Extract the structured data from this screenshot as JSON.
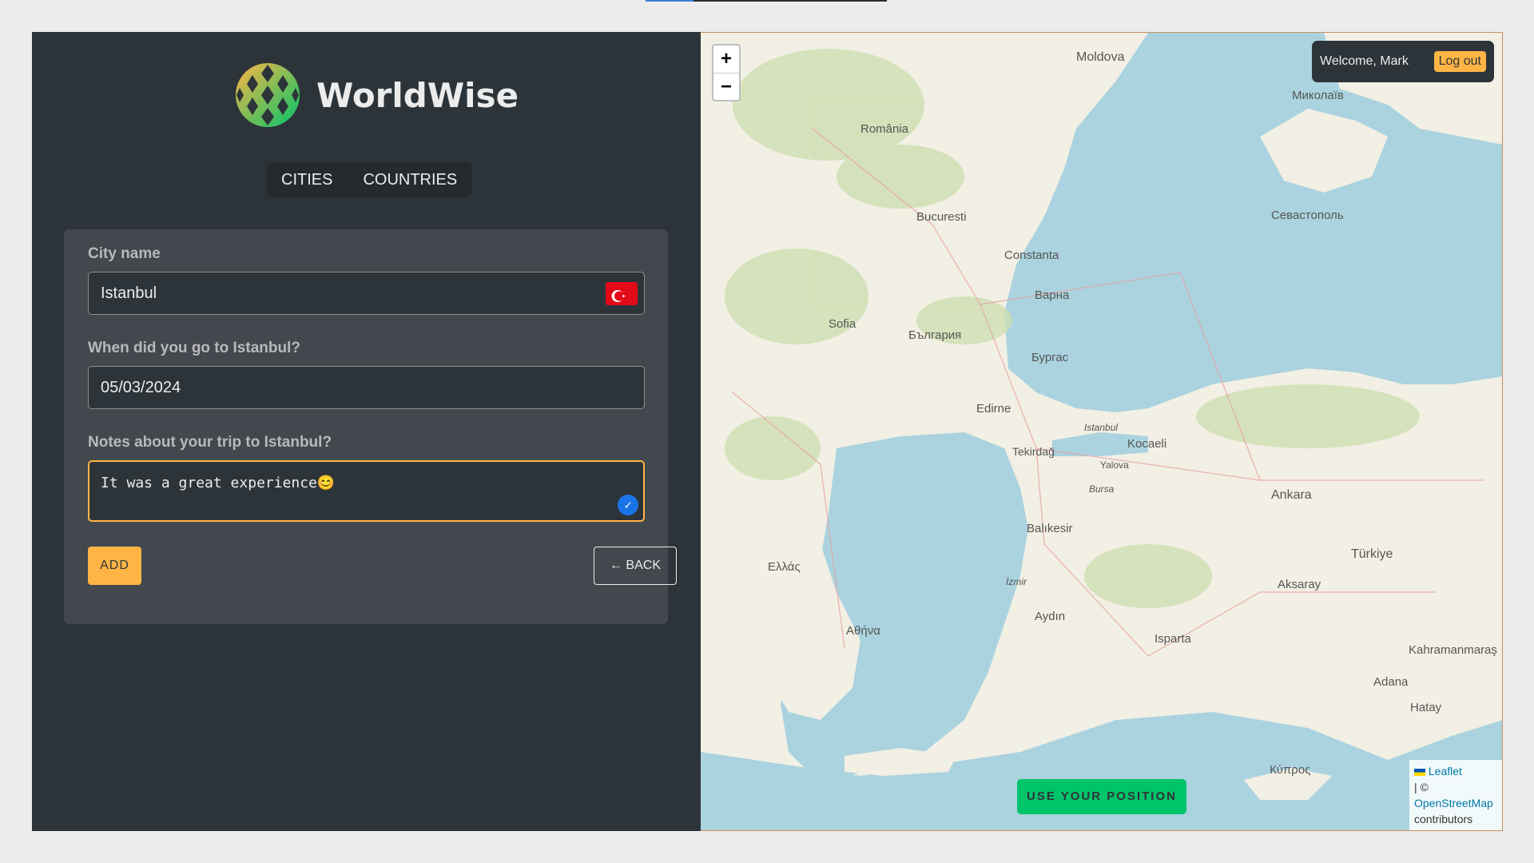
{
  "app": {
    "name": "WorldWise"
  },
  "nav": {
    "items": [
      "CITIES",
      "COUNTRIES"
    ]
  },
  "form": {
    "city_label": "City name",
    "city_value": "Istanbul",
    "date_label": "When did you go to Istanbul?",
    "date_value": "05/03/2024",
    "notes_label": "Notes about your trip to Istanbul?",
    "notes_value": "It was a great experience😊",
    "add_label": "ADD",
    "back_label": "← BACK"
  },
  "map": {
    "zoom_in": "+",
    "zoom_out": "−",
    "welcome": "Welcome, Mark",
    "logout": "Log out",
    "use_position": "USE YOUR POSITION",
    "attribution": {
      "leaflet": "Leaflet",
      "sep": "| ©",
      "osm": "OpenStreetMap",
      "contributors": "contributors"
    },
    "labels": [
      "Moldova",
      "România",
      "Bucuresti",
      "Constanta",
      "Варна",
      "Бургас",
      "Edirne",
      "Istanbul",
      "Kocaeli",
      "Bursa",
      "Balıkesir",
      "Ankara",
      "Türkiye",
      "Aksaray",
      "İzmir",
      "Aydın",
      "Isparta",
      "Ελλάς",
      "Αθήνα",
      "Кύπρος",
      "Севастополь",
      "Миколаїв",
      "Tekirdağ",
      "Yalova",
      "Sofia",
      "България",
      "Hatay",
      "Adana",
      "Kahramanmaraş"
    ]
  },
  "colors": {
    "sidebar": "#2d3439",
    "panel": "#42484d",
    "accent": "#ffb545",
    "brand_green": "#00c46a",
    "sea": "#aad3df"
  }
}
